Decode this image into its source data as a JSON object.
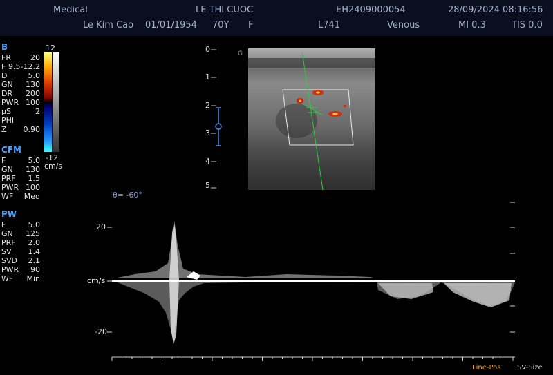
{
  "header": {
    "app": "Medical",
    "patient_name": "LE THI CUOC",
    "exam_id": "EH2409000054",
    "datetime": "28/09/2024 08:16:56",
    "physician": "Le Kim Cao",
    "dob": "01/01/1954",
    "age": "70Y",
    "sex": "F",
    "probe": "L741",
    "preset": "Venous",
    "mi": "MI 0.3",
    "tis": "TIS 0.0"
  },
  "b_mode": {
    "title": "B",
    "params": [
      {
        "k": "FR",
        "v": "20"
      },
      {
        "k": "F",
        "v": "9.5-12.2"
      },
      {
        "k": "D",
        "v": "5.0"
      },
      {
        "k": "GN",
        "v": "130"
      },
      {
        "k": "DR",
        "v": "200"
      },
      {
        "k": "PWR",
        "v": "100"
      },
      {
        "k": "µS",
        "v": "2"
      },
      {
        "k": "PHI",
        "v": ""
      },
      {
        "k": "Z",
        "v": "0.90"
      }
    ]
  },
  "color_bar": {
    "top": "12",
    "bottom": "-12",
    "unit": "cm/s"
  },
  "cfm": {
    "title": "CFM",
    "params": [
      {
        "k": "F",
        "v": "5.0"
      },
      {
        "k": "GN",
        "v": "130"
      },
      {
        "k": "PRF",
        "v": "1.5"
      },
      {
        "k": "PWR",
        "v": "100"
      },
      {
        "k": "WF",
        "v": "Med"
      }
    ]
  },
  "pw": {
    "title": "PW",
    "params": [
      {
        "k": "F",
        "v": "5.0"
      },
      {
        "k": "GN",
        "v": "125"
      },
      {
        "k": "PRF",
        "v": "2.0"
      },
      {
        "k": "SV",
        "v": "1.4"
      },
      {
        "k": "SVD",
        "v": "2.1"
      },
      {
        "k": "PWR",
        "v": "90"
      },
      {
        "k": "WF",
        "v": "Min"
      }
    ]
  },
  "depth_scale": [
    "0",
    "1",
    "2",
    "3",
    "4",
    "5"
  ],
  "probe_marker": "G",
  "doppler": {
    "angle": "θ= -60°",
    "scale_top": "20",
    "unit": "cm/s",
    "scale_bottom": "-20"
  },
  "controls": {
    "line_pos": "Line-Pos",
    "sv_size": "SV-Size"
  },
  "colors": {
    "header_bg": "#0a0e1e",
    "section": "#4aa3ff",
    "control": "#e5a43a",
    "doppler_line": "#ffffff",
    "cursor": "#2ecc40"
  }
}
